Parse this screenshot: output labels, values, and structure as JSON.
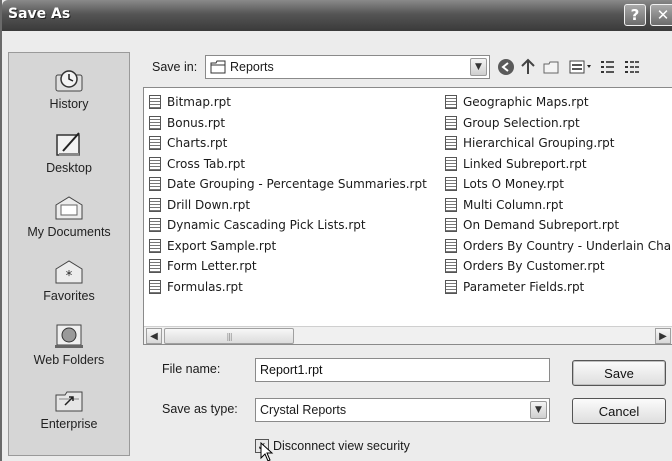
{
  "window": {
    "title": "Save As",
    "help_glyph": "?",
    "close_glyph": "✕"
  },
  "places": [
    {
      "label": "History",
      "icon": "history-icon"
    },
    {
      "label": "Desktop",
      "icon": "desktop-icon"
    },
    {
      "label": "My Documents",
      "icon": "my-documents-icon"
    },
    {
      "label": "Favorites",
      "icon": "favorites-icon"
    },
    {
      "label": "Web Folders",
      "icon": "web-folders-icon"
    },
    {
      "label": "Enterprise",
      "icon": "enterprise-icon"
    }
  ],
  "save_in": {
    "label": "Save in:",
    "value": "Reports"
  },
  "toolbar": {
    "back": "back-icon",
    "up": "up-folder-icon",
    "new_folder": "new-folder-icon",
    "views": "views-menu-icon",
    "list": "list-view-icon",
    "details": "details-view-icon"
  },
  "files": {
    "left": [
      "Bitmap.rpt",
      "Bonus.rpt",
      "Charts.rpt",
      "Cross Tab.rpt",
      "Date Grouping - Percentage Summaries.rpt",
      "Drill Down.rpt",
      "Dynamic Cascading Pick Lists.rpt",
      "Export Sample.rpt",
      "Form Letter.rpt",
      "Formulas.rpt"
    ],
    "right": [
      "Geographic Maps.rpt",
      "Group Selection.rpt",
      "Hierarchical Grouping.rpt",
      "Linked Subreport.rpt",
      "Lots O Money.rpt",
      "Multi Column.rpt",
      "On Demand Subreport.rpt",
      "Orders By Country - Underlain Cha",
      "Orders By Customer.rpt",
      "Parameter Fields.rpt"
    ]
  },
  "file_name": {
    "label": "File name:",
    "value": "Report1.rpt"
  },
  "save_as_type": {
    "label": "Save as type:",
    "value": "Crystal Reports"
  },
  "buttons": {
    "save": "Save",
    "cancel": "Cancel"
  },
  "disconnect": {
    "label": "Disconnect view security",
    "checked": true
  },
  "colors": {
    "titlebar": "#4a4a4a",
    "dialog_bg": "#ececec",
    "places_bg": "#d6d6d6"
  }
}
